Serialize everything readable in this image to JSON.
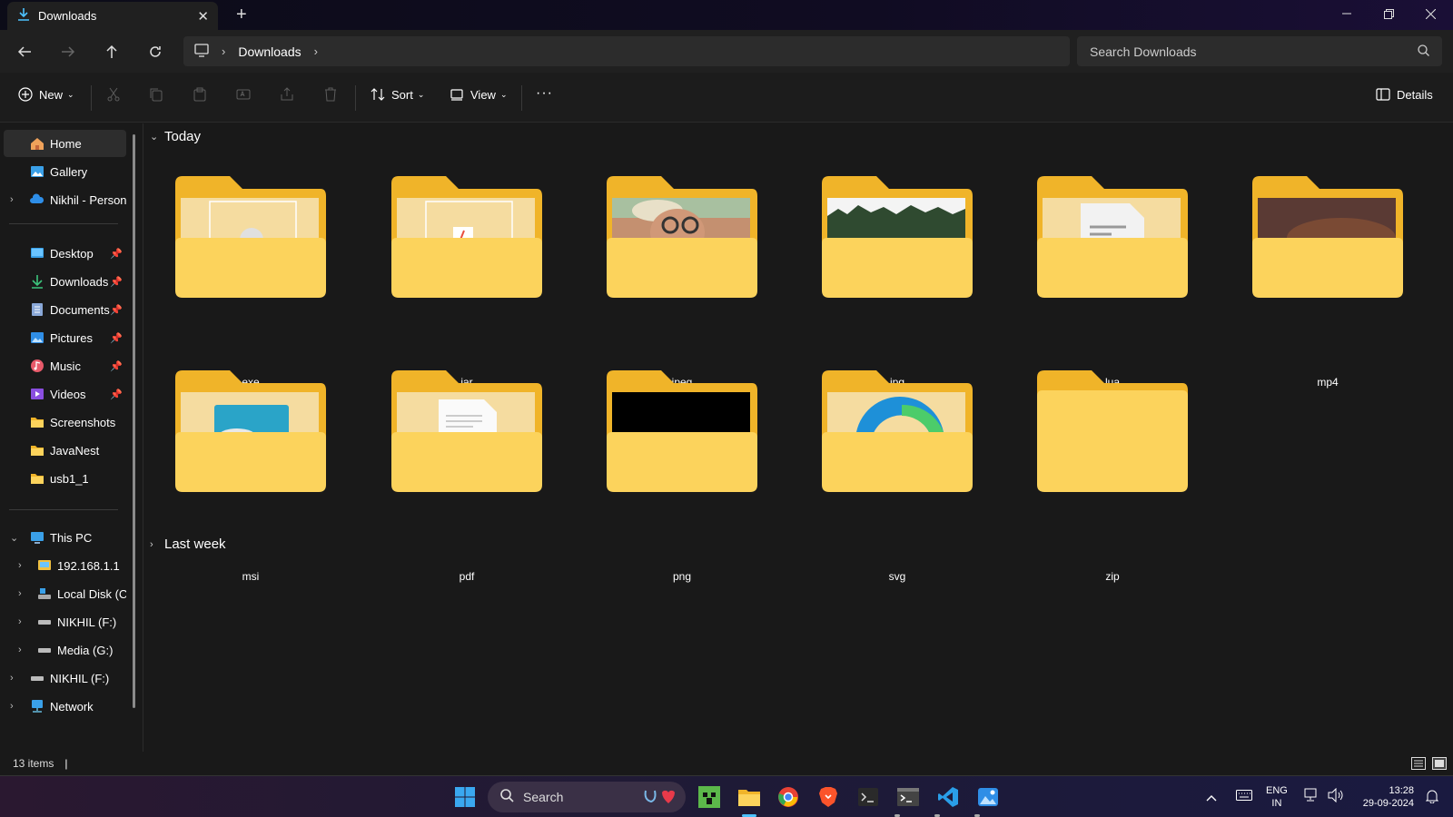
{
  "window": {
    "tab_title": "Downloads",
    "new_tab_glyph": "+",
    "close_glyph": "✕"
  },
  "address": {
    "crumbs": [
      "Downloads"
    ],
    "search_placeholder": "Search Downloads"
  },
  "toolbar": {
    "new_label": "New",
    "sort_label": "Sort",
    "view_label": "View",
    "more_glyph": "···",
    "details_label": "Details"
  },
  "sidebar": {
    "top": [
      {
        "label": "Home",
        "icon": "home-icon"
      },
      {
        "label": "Gallery",
        "icon": "gallery-icon"
      },
      {
        "label": "Nikhil - Persona",
        "icon": "onedrive-icon"
      }
    ],
    "pinned": [
      {
        "label": "Desktop",
        "icon": "desktop-icon"
      },
      {
        "label": "Downloads",
        "icon": "downloads-icon"
      },
      {
        "label": "Documents",
        "icon": "documents-icon"
      },
      {
        "label": "Pictures",
        "icon": "pictures-icon"
      },
      {
        "label": "Music",
        "icon": "music-icon"
      },
      {
        "label": "Videos",
        "icon": "videos-icon"
      },
      {
        "label": "Screenshots",
        "icon": "folder-icon"
      },
      {
        "label": "JavaNest",
        "icon": "folder-icon"
      },
      {
        "label": "usb1_1",
        "icon": "folder-icon"
      }
    ],
    "devices": [
      {
        "label": "This PC",
        "icon": "this-pc-icon"
      },
      {
        "label": "192.168.1.1",
        "icon": "network-drive-icon"
      },
      {
        "label": "Local Disk (C:)",
        "icon": "disk-icon"
      },
      {
        "label": "NIKHIL (F:)",
        "icon": "usb-drive-icon"
      },
      {
        "label": "Media (G:)",
        "icon": "usb-drive-icon"
      },
      {
        "label": "NIKHIL (F:)",
        "icon": "usb-drive-icon"
      },
      {
        "label": "Network",
        "icon": "network-icon"
      }
    ]
  },
  "content": {
    "group_today": "Today",
    "group_last_week": "Last week",
    "folders": [
      {
        "name": "exe"
      },
      {
        "name": "jar"
      },
      {
        "name": "jpeg"
      },
      {
        "name": "jpg"
      },
      {
        "name": "lua"
      },
      {
        "name": "mp4"
      },
      {
        "name": "msi"
      },
      {
        "name": "pdf"
      },
      {
        "name": "png"
      },
      {
        "name": "svg"
      },
      {
        "name": "zip"
      }
    ]
  },
  "status": {
    "item_count": "13 items"
  },
  "taskbar": {
    "search_label": "Search",
    "lang_top": "ENG",
    "lang_bottom": "IN",
    "time": "13:28",
    "date": "29-09-2024"
  },
  "colors": {
    "folder_back": "#f0b429",
    "folder_front": "#fcd35c",
    "accent": "#4cc2ff"
  }
}
